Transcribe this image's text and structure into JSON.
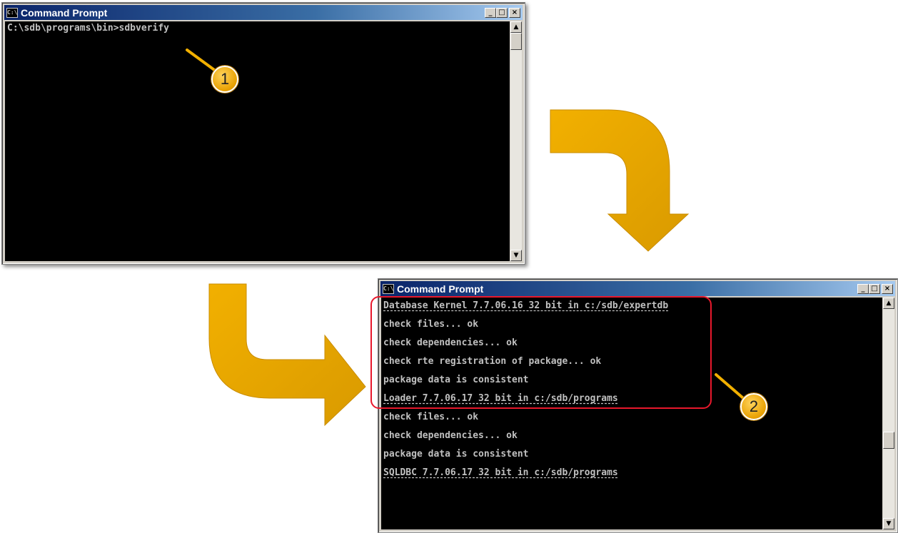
{
  "window1": {
    "title": "Command Prompt",
    "icon_label": "C:\\",
    "buttons": {
      "minimize": "_",
      "maximize": "□",
      "close": "×"
    },
    "lines": [
      "C:\\sdb\\programs\\bin>sdbverify"
    ]
  },
  "window2": {
    "title": "Command Prompt",
    "icon_label": "C:\\",
    "buttons": {
      "minimize": "_",
      "maximize": "□",
      "close": "×"
    },
    "lines": [
      "Database Kernel 7.7.06.16 32 bit in c:/sdb/expertdb",
      "check files... ok",
      "check dependencies... ok",
      "check rte registration of package... ok",
      "package data is consistent",
      "Loader 7.7.06.17 32 bit in c:/sdb/programs",
      "check files... ok",
      "check dependencies... ok",
      "package data is consistent",
      "SQLDBC 7.7.06.17 32 bit in c:/sdb/programs"
    ]
  },
  "callouts": {
    "step1": "1",
    "step2": "2"
  },
  "colors": {
    "arrow": "#e8a400",
    "highlight": "#e8182c",
    "console_bg": "#000000",
    "console_text": "#c0c0c0"
  },
  "icons": [
    "cmd-icon",
    "minimize-icon",
    "maximize-icon",
    "close-icon",
    "scroll-up-icon",
    "scroll-down-icon",
    "curved-arrow"
  ]
}
